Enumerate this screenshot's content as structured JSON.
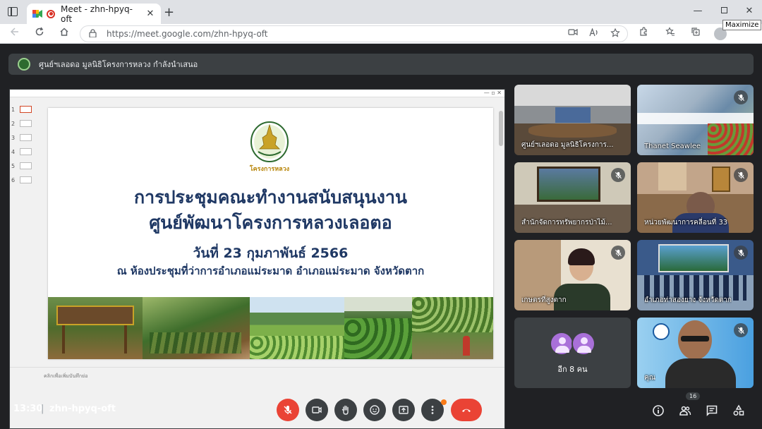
{
  "browser": {
    "tab_title": "Meet - zhn-hpyq-oft",
    "tab_close": "✕",
    "new_tab": "+",
    "url": "https://meet.google.com/zhn-hpyq-oft",
    "tooltip": "Maximize",
    "win_min": "—",
    "win_close": "✕"
  },
  "presenter": {
    "text": "ศูนย์ฯเลอดอ มูลนิธิโครงการหลวง กำลังนำเสนอ"
  },
  "slide": {
    "title_line1": "การประชุมคณะทำงานสนับสนุนงาน",
    "title_line2": "ศูนย์พัฒนาโครงการหลวงเลอตอ",
    "date_line": "วันที่  23 กุมภาพันธ์ 2566",
    "venue_line": "ณ ห้องประชุมที่ว่าการอำเภอแม่ระมาด  อำเภอแม่ระมาด จังหวัดตาก",
    "logo_text": "โครงการหลวง",
    "notes_placeholder": "คลิกเพื่อเพิ่มบันทึกย่อ",
    "thumbnails": [
      "1",
      "2",
      "3",
      "4",
      "5",
      "6"
    ]
  },
  "tiles": [
    {
      "name": "ศูนย์ฯเลอดอ มูลนิธิโครงการ...",
      "muted": false
    },
    {
      "name": "Thanet Seawlee",
      "muted": true
    },
    {
      "name": "สำนักจัดการทรัพยากรป่าไม้...",
      "muted": true
    },
    {
      "name": "หน่วยพัฒนาการคลี่อนที่ 33",
      "muted": true
    },
    {
      "name": "เกษตรที่สูงตาก",
      "muted": true
    },
    {
      "name": "อำเภอท่าสองยาง จังหวัดตาก",
      "muted": true
    },
    {
      "name": "คุณ",
      "muted": true
    }
  ],
  "others": {
    "label": "อีก 8 คน"
  },
  "bottom": {
    "time": "13:30",
    "separator": "|",
    "meeting_code": "zhn-hpyq-oft",
    "people_count": "16"
  },
  "colors": {
    "meet_bg": "#202124",
    "control_bg": "#3c4043",
    "danger": "#ea4335",
    "slide_title": "#1f3864"
  }
}
